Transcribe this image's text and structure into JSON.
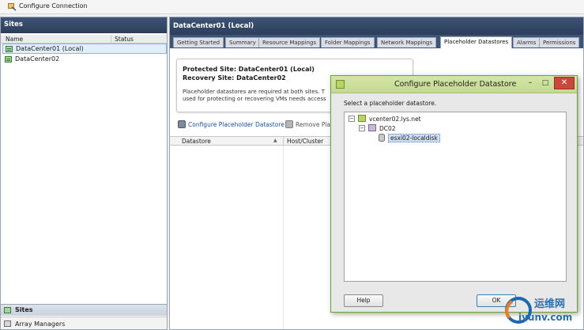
{
  "toolbar": {
    "configure_label": "Configure Connection"
  },
  "left_panel": {
    "header": "Sites",
    "columns": {
      "name": "Name",
      "status": "Status"
    },
    "sites": [
      {
        "label": "DataCenter01 (Local)"
      },
      {
        "label": "DataCenter02"
      }
    ],
    "nav": {
      "sites": "Sites",
      "array_managers": "Array Managers"
    }
  },
  "right_panel": {
    "header": "DataCenter01 (Local)",
    "tabs": [
      "Getting Started",
      "Summary",
      "Resource Mappings",
      "Folder Mappings",
      "Network Mappings",
      "Placeholder Datastores",
      "Alarms",
      "Permissions"
    ],
    "summary": {
      "protected_site": "Protected Site: DataCenter01 (Local)",
      "recovery_site": "Recovery Site: DataCenter02",
      "description_1": "Placeholder datastores are required at both sites. T",
      "description_2": "used for protecting or recovering VMs needs access"
    },
    "actions": {
      "configure": "Configure Placeholder Datastore",
      "remove": "Remove Place"
    },
    "grid_columns": {
      "datastore": "Datastore",
      "host_cluster": "Host/Cluster"
    }
  },
  "dialog": {
    "title": "Configure Placeholder Datastore",
    "prompt": "Select a placeholder datastore.",
    "tree": {
      "vcenter": "vcenter02.lys.net",
      "datacenter": "DC02",
      "datastore": "esxi02-localdisk"
    },
    "buttons": {
      "help": "Help",
      "ok": "OK"
    },
    "window_controls": {
      "minimize": "–",
      "maximize": "□",
      "close": "✕"
    }
  },
  "watermark": {
    "text_cn": "运维网",
    "text_domain": "iyunv.com"
  }
}
